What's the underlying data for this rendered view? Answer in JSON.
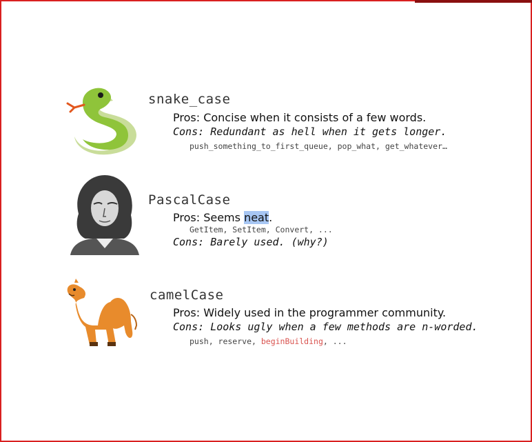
{
  "entries": [
    {
      "title": "snake_case",
      "pros_label": "Pros:",
      "pros_text": "Concise when it consists of a few words.",
      "cons_label": "Cons:",
      "cons_text": "Redundant as hell when it gets longer.",
      "examples": "push_something_to_first_queue, pop_what, get_whatever…",
      "image": "snake-illustration"
    },
    {
      "title": "PascalCase",
      "pros_label": "Pros:",
      "pros_text_before": "Seems ",
      "pros_text_highlight": "neat",
      "pros_text_after": ".",
      "examples": "GetItem, SetItem, Convert, ...",
      "cons_label": "Cons:",
      "cons_text": "Barely used. (why?)",
      "image": "pascal-portrait"
    },
    {
      "title": "camelCase",
      "pros_label": "Pros:",
      "pros_text": "Widely used in the programmer community.",
      "cons_label": "Cons:",
      "cons_text": "Looks ugly when a few methods are n-worded.",
      "examples_before": "push, reserve, ",
      "examples_red": "beginBuilding",
      "examples_after": ", ...",
      "image": "camel-illustration"
    }
  ],
  "colors": {
    "frame": "#d92020",
    "highlight": "#a7c6f3",
    "example_red": "#d9534f"
  }
}
